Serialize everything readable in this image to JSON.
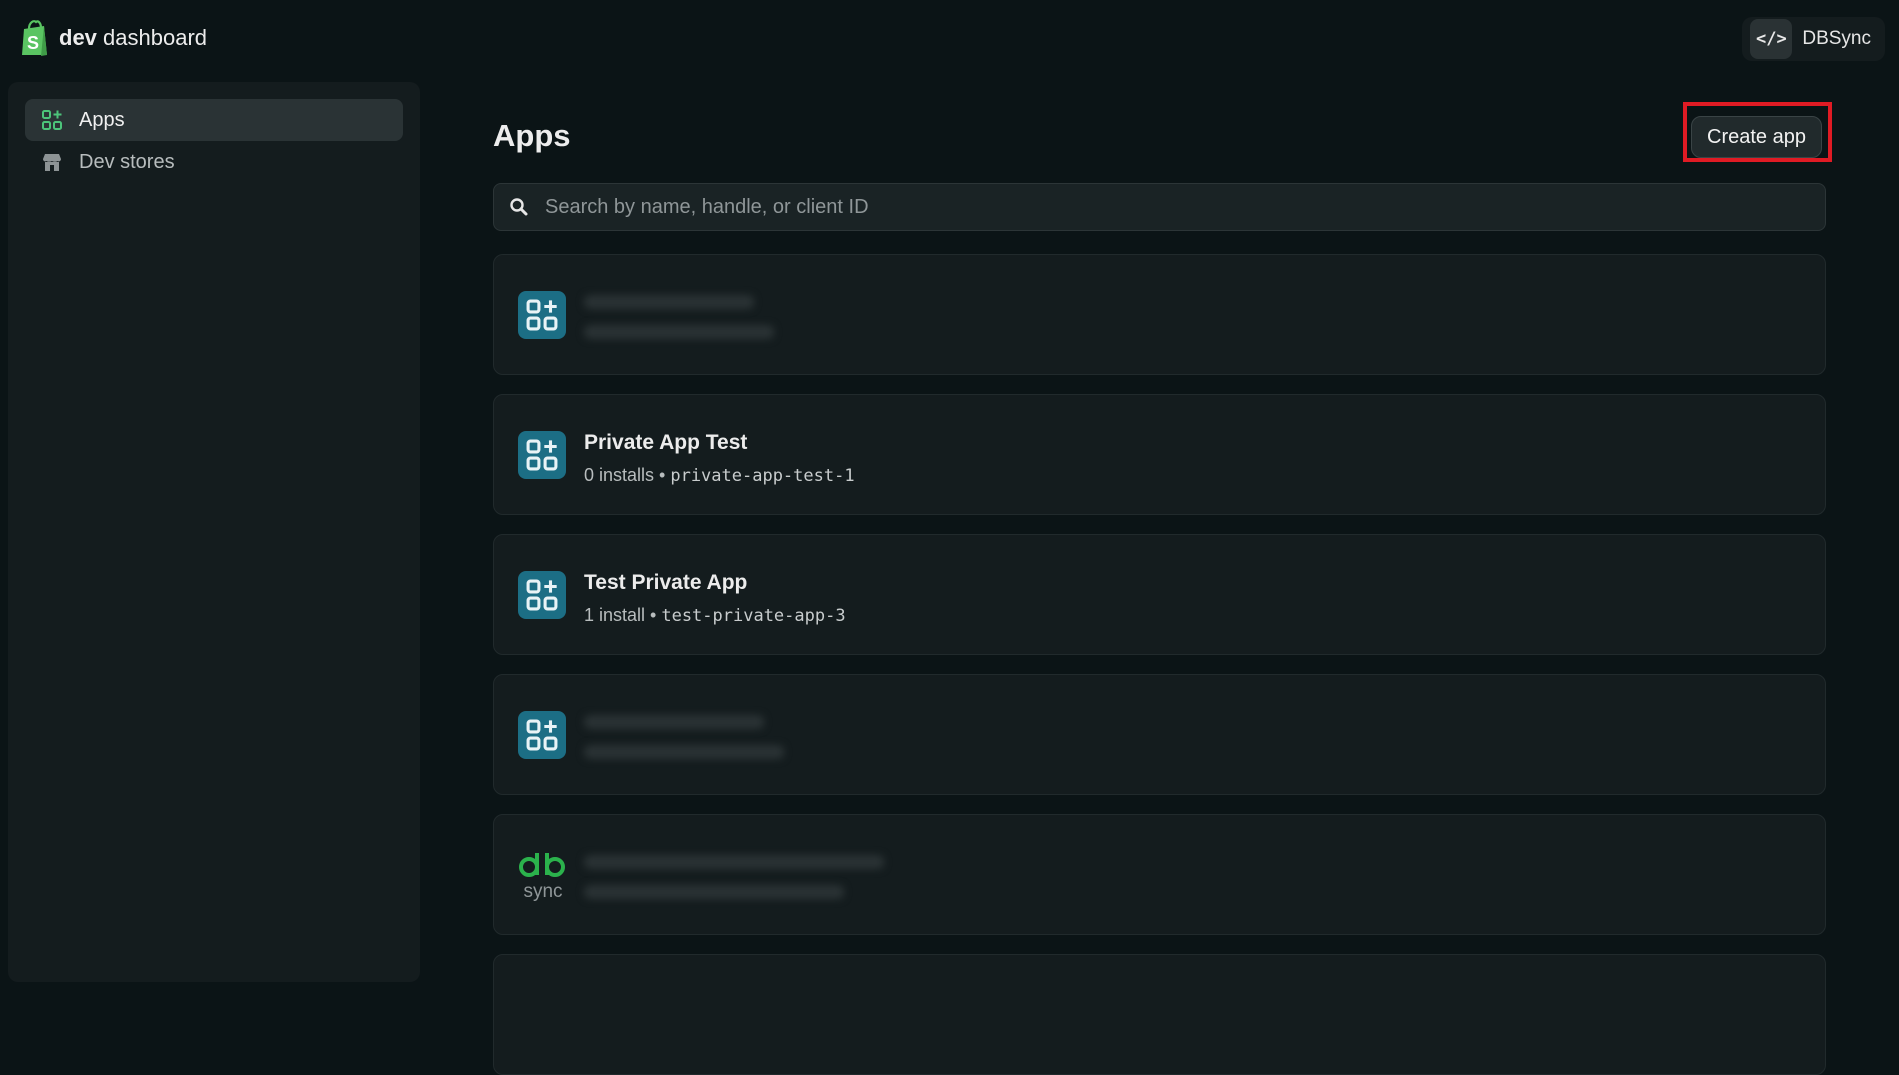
{
  "header": {
    "brand_bold": "dev",
    "brand_rest": " dashboard",
    "account_name": "DBSync",
    "account_icon": "code-icon"
  },
  "sidebar": {
    "items": [
      {
        "label": "Apps",
        "icon": "apps-icon",
        "active": true
      },
      {
        "label": "Dev stores",
        "icon": "store-icon",
        "active": false
      }
    ]
  },
  "main": {
    "title": "Apps",
    "create_label": "Create app",
    "search": {
      "placeholder": "Search by name, handle, or client ID",
      "value": ""
    },
    "apps": [
      {
        "name": "",
        "installs": "",
        "handle": "",
        "icon": "apps-icon",
        "redacted": true
      },
      {
        "name": "Private App Test",
        "installs": "0 installs",
        "handle": "private-app-test-1",
        "icon": "apps-icon",
        "redacted": false
      },
      {
        "name": "Test Private App",
        "installs": "1 install",
        "handle": "test-private-app-3",
        "icon": "apps-icon",
        "redacted": false
      },
      {
        "name": "",
        "installs": "",
        "handle": "",
        "icon": "apps-icon",
        "redacted": true
      },
      {
        "name": "",
        "installs": "",
        "handle": "",
        "icon": "dbsync-logo",
        "redacted": true
      }
    ]
  },
  "colors": {
    "background": "#0b1416",
    "panel": "#141c1e",
    "accent_green": "#4cc47a",
    "app_icon_bg": "#1c6e85",
    "highlight": "#e01b24",
    "dbsync_green": "#2bb24c"
  }
}
